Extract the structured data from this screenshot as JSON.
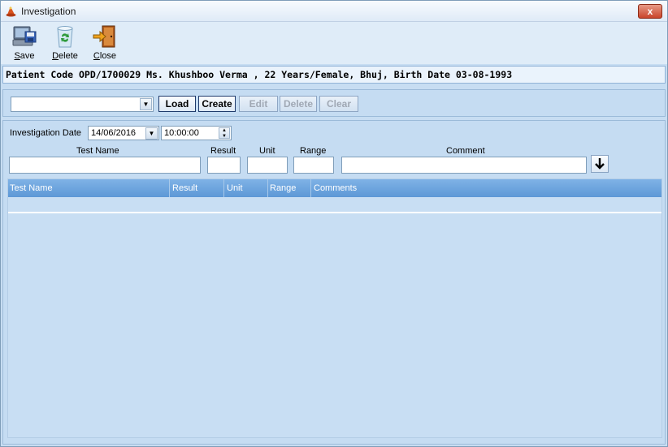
{
  "window": {
    "title": "Investigation",
    "close_glyph": "x"
  },
  "toolbar": {
    "save_label": "Save",
    "delete_label": "Delete",
    "close_label": "Close",
    "save_icon": "save-computer-icon",
    "delete_icon": "recycle-bin-icon",
    "close_icon": "exit-door-icon"
  },
  "patient": {
    "info": "Patient Code OPD/1700029 Ms. Khushboo Verma , 22 Years/Female, Bhuj, Birth Date 03-08-1993"
  },
  "actions": {
    "combo_value": "",
    "load_label": "Load",
    "create_label": "Create",
    "edit_label": "Edit",
    "delete_label": "Delete",
    "clear_label": "Clear"
  },
  "entry": {
    "date_label": "Investigation Date",
    "date_value": "14/06/2016",
    "time_value": "10:00:00",
    "test_name_label": "Test Name",
    "result_label": "Result",
    "unit_label": "Unit",
    "range_label": "Range",
    "comment_label": "Comment"
  },
  "grid": {
    "columns": [
      "Test Name",
      "Result",
      "Unit",
      "Range",
      "Comments"
    ],
    "rows": []
  },
  "colors": {
    "background": "#c7ddf2",
    "grid_header": "#6aa3dd",
    "close_button": "#c9452b"
  }
}
